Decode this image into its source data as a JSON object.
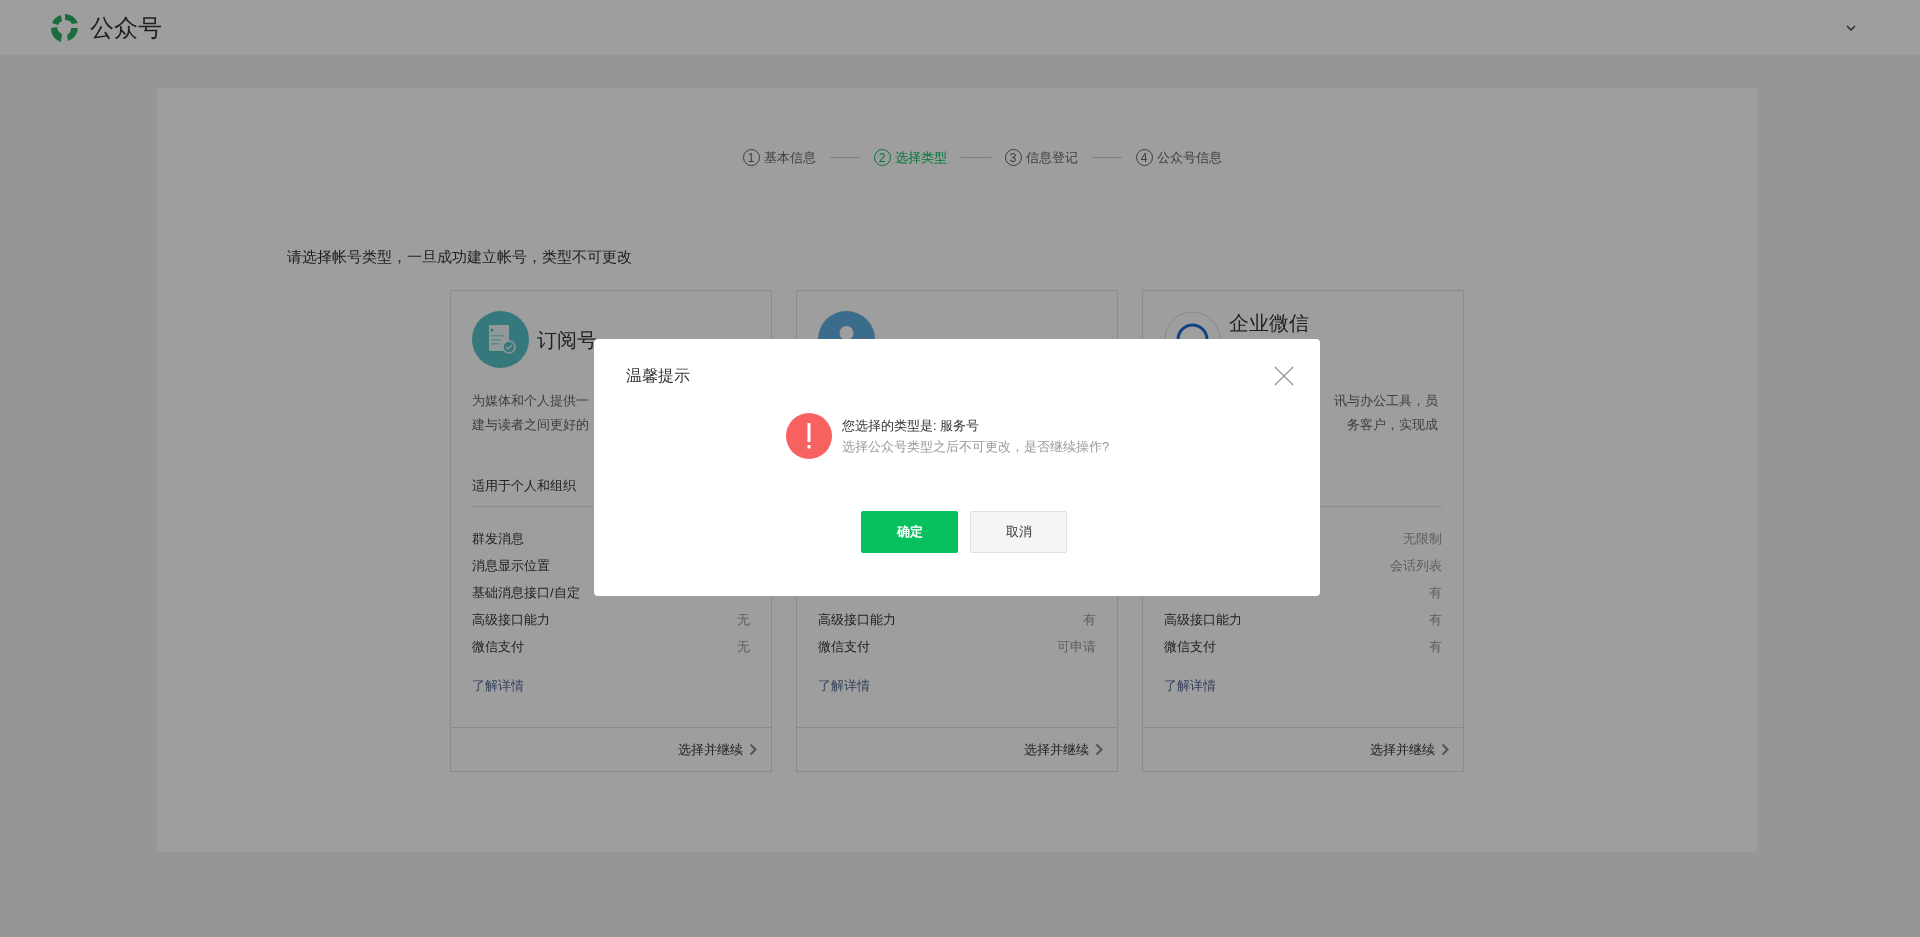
{
  "header": {
    "title": "公众号"
  },
  "steps": [
    {
      "number": "1",
      "label": "基本信息",
      "selected": false
    },
    {
      "number": "2",
      "label": "选择类型",
      "selected": true
    },
    {
      "number": "3",
      "label": "信息登记",
      "selected": false
    },
    {
      "number": "4",
      "label": "公众号信息",
      "selected": false
    }
  ],
  "prompt": "请选择帐号类型，一旦成功建立帐号，类型不可更改",
  "cards": [
    {
      "kind": "document",
      "title": "订阅号",
      "description_lines": [
        "为媒体和个人提供一",
        "建与读者之间更好的"
      ],
      "subtitle": "适用于个人和组织",
      "rows": [
        {
          "label": "群发消息"
        },
        {
          "label": "消息显示位置"
        },
        {
          "label": "基础消息接口/自定"
        },
        {
          "label": "高级接口能力",
          "value": "无"
        },
        {
          "label": "微信支付",
          "value": "无"
        }
      ],
      "link": "了解详情",
      "action": "选择并继续"
    },
    {
      "kind": "person",
      "rows": [
        {},
        {},
        {},
        {
          "label": "高级接口能力",
          "value": "有"
        },
        {
          "label": "微信支付",
          "value": "可申请"
        }
      ],
      "link": "了解详情",
      "action": "选择并继续"
    },
    {
      "kind": "ring",
      "title": "企业微信",
      "description_lines": [
        "讯与办公工具，员",
        "务客户，实现成"
      ],
      "rows": [
        {
          "value": "无限制"
        },
        {
          "value": "会话列表"
        },
        {
          "value": "有"
        },
        {
          "label": "高级接口能力",
          "value": "有"
        },
        {
          "label": "微信支付",
          "value": "有"
        }
      ],
      "link": "了解详情",
      "action": "选择并继续"
    }
  ],
  "dialog": {
    "title": "温馨提示",
    "message": "您选择的类型是: 服务号",
    "note": "选择公众号类型之后不可更改，是否继续操作?",
    "buttons": [
      {
        "kind": "primary",
        "label": "确定"
      },
      {
        "kind": "default",
        "label": "取消"
      }
    ]
  }
}
